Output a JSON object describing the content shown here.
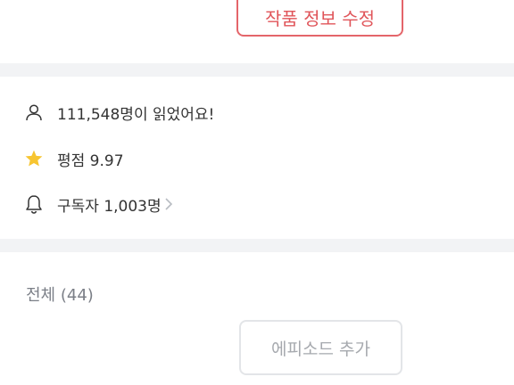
{
  "header": {
    "edit_work_label": "작품 정보 수정"
  },
  "stats": {
    "readers_text": "111,548명이 읽었어요!",
    "rating_text": "평점 9.97",
    "subscribers_text": "구독자 1,003명"
  },
  "icons": {
    "readers": "person-icon",
    "rating": "star-icon",
    "subscribers": "bell-icon",
    "subscribers_more": "chevron-right-icon"
  },
  "episodes": {
    "title": "전체 (44)",
    "add_label": "에피소드 추가"
  },
  "colors": {
    "accent": "#e0555a",
    "star": "#f7c531",
    "divider": "#f2f3f5"
  }
}
